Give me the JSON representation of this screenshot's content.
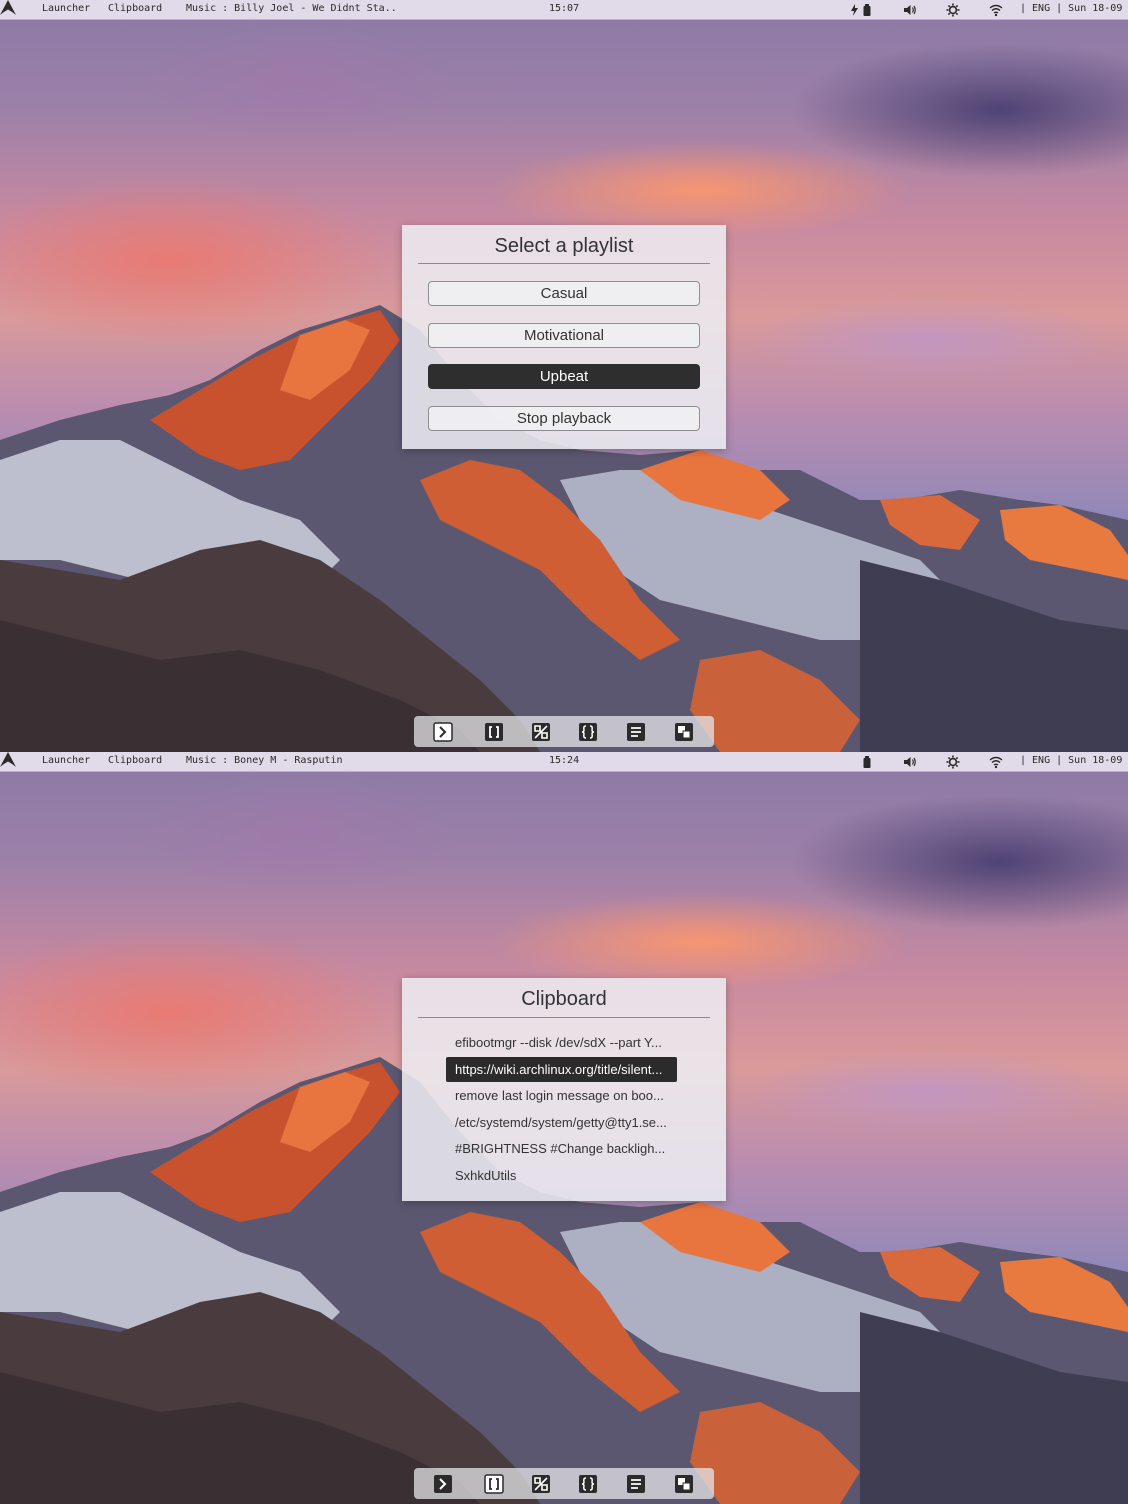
{
  "screens": [
    {
      "topbar": {
        "launcher": "Launcher",
        "clipboard": "Clipboard",
        "music": "Music : Billy Joel - We Didnt Sta..",
        "clock": "15:07",
        "lang": "| ENG | Sun 18-09",
        "status_icons": [
          "charging-bolt-icon",
          "battery-icon",
          "volume-icon",
          "brightness-icon",
          "wifi-icon"
        ]
      },
      "popup": {
        "title": "Select a playlist",
        "buttons": [
          {
            "label": "Casual",
            "active": false
          },
          {
            "label": "Motivational",
            "active": false
          },
          {
            "label": "Upbeat",
            "active": true
          },
          {
            "label": "Stop playback",
            "active": false
          }
        ]
      },
      "dock": {
        "active_index": 0,
        "items": [
          "terminal-icon",
          "brackets-icon",
          "layout-icon",
          "braces-icon",
          "notes-icon",
          "windows-icon"
        ]
      }
    },
    {
      "topbar": {
        "launcher": "Launcher",
        "clipboard": "Clipboard",
        "music": "Music : Boney M - Rasputin",
        "clock": "15:24",
        "lang": "| ENG | Sun 18-09",
        "status_icons": [
          "battery-icon",
          "volume-icon",
          "brightness-icon",
          "wifi-icon"
        ]
      },
      "popup": {
        "title": "Clipboard",
        "items": [
          {
            "label": "efibootmgr --disk /dev/sdX --part Y...",
            "active": false
          },
          {
            "label": "https://wiki.archlinux.org/title/silent...",
            "active": true
          },
          {
            "label": "remove last login message on boo...",
            "active": false
          },
          {
            "label": "/etc/systemd/system/getty@tty1.se...",
            "active": false
          },
          {
            "label": "#BRIGHTNESS #Change backligh...",
            "active": false
          },
          {
            "label": "SxhkdUtils",
            "active": false
          }
        ]
      },
      "dock": {
        "active_index": 1,
        "items": [
          "terminal-icon",
          "brackets-icon",
          "layout-icon",
          "braces-icon",
          "notes-icon",
          "windows-icon"
        ]
      }
    }
  ],
  "colors": {
    "bar_bg": "#e8e2ee",
    "active_item": "#2e2e2e",
    "popup_bg": "#ececf0"
  }
}
